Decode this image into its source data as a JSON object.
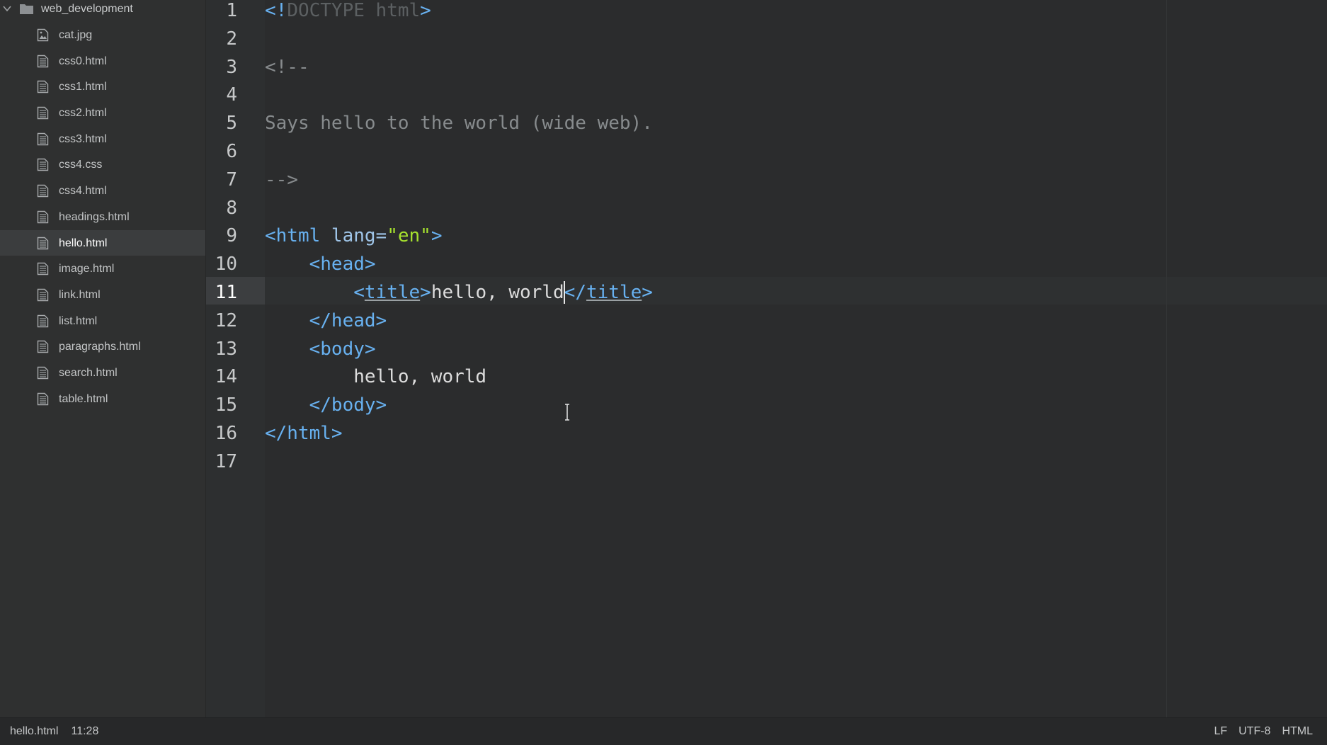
{
  "sidebar": {
    "root": {
      "label": "web_development",
      "icon": "folder-icon",
      "expanded": true
    },
    "files": [
      {
        "label": "cat.jpg",
        "icon": "image-file-icon",
        "selected": false
      },
      {
        "label": "css0.html",
        "icon": "file-text-icon",
        "selected": false
      },
      {
        "label": "css1.html",
        "icon": "file-text-icon",
        "selected": false
      },
      {
        "label": "css2.html",
        "icon": "file-text-icon",
        "selected": false
      },
      {
        "label": "css3.html",
        "icon": "file-text-icon",
        "selected": false
      },
      {
        "label": "css4.css",
        "icon": "file-text-icon",
        "selected": false
      },
      {
        "label": "css4.html",
        "icon": "file-text-icon",
        "selected": false
      },
      {
        "label": "headings.html",
        "icon": "file-text-icon",
        "selected": false
      },
      {
        "label": "hello.html",
        "icon": "file-text-icon",
        "selected": true
      },
      {
        "label": "image.html",
        "icon": "file-text-icon",
        "selected": false
      },
      {
        "label": "link.html",
        "icon": "file-text-icon",
        "selected": false
      },
      {
        "label": "list.html",
        "icon": "file-text-icon",
        "selected": false
      },
      {
        "label": "paragraphs.html",
        "icon": "file-text-icon",
        "selected": false
      },
      {
        "label": "search.html",
        "icon": "file-text-icon",
        "selected": false
      },
      {
        "label": "table.html",
        "icon": "file-text-icon",
        "selected": false
      }
    ]
  },
  "editor": {
    "active_line": 11,
    "line_numbers": [
      "1",
      "2",
      "3",
      "4",
      "5",
      "6",
      "7",
      "8",
      "9",
      "10",
      "11",
      "12",
      "13",
      "14",
      "15",
      "16",
      "17"
    ],
    "lines": [
      [
        {
          "t": "<!",
          "c": "tag"
        },
        {
          "t": "DOCTYPE html",
          "c": "doc"
        },
        {
          "t": ">",
          "c": "tag"
        }
      ],
      [],
      [
        {
          "t": "<!--",
          "c": "cmt"
        }
      ],
      [],
      [
        {
          "t": "Says hello to the world (wide web).",
          "c": "cmt"
        }
      ],
      [],
      [
        {
          "t": "-->",
          "c": "cmt"
        }
      ],
      [],
      [
        {
          "t": "<html ",
          "c": "tag"
        },
        {
          "t": "lang=",
          "c": "attr"
        },
        {
          "t": "\"en\"",
          "c": "str"
        },
        {
          "t": ">",
          "c": "tag"
        }
      ],
      [
        {
          "t": "    ",
          "c": "text"
        },
        {
          "t": "<head>",
          "c": "tag"
        }
      ],
      [
        {
          "t": "        ",
          "c": "text"
        },
        {
          "t": "<",
          "c": "tag"
        },
        {
          "t": "title",
          "c": "tag",
          "u": true
        },
        {
          "t": ">",
          "c": "tag"
        },
        {
          "t": "hello, world",
          "c": "text"
        },
        {
          "t": "</",
          "c": "tag"
        },
        {
          "t": "title",
          "c": "tag",
          "u": true
        },
        {
          "t": ">",
          "c": "tag"
        }
      ],
      [
        {
          "t": "    ",
          "c": "text"
        },
        {
          "t": "</head>",
          "c": "tag"
        }
      ],
      [
        {
          "t": "    ",
          "c": "text"
        },
        {
          "t": "<body>",
          "c": "tag"
        }
      ],
      [
        {
          "t": "        ",
          "c": "text"
        },
        {
          "t": "hello, world",
          "c": "text"
        }
      ],
      [
        {
          "t": "    ",
          "c": "text"
        },
        {
          "t": "</body>",
          "c": "tag"
        }
      ],
      [
        {
          "t": "</html>",
          "c": "tag"
        }
      ],
      []
    ]
  },
  "statusbar": {
    "file_name": "hello.html",
    "cursor_position": "11:28",
    "line_ending": "LF",
    "encoding": "UTF-8",
    "grammar": "HTML"
  }
}
